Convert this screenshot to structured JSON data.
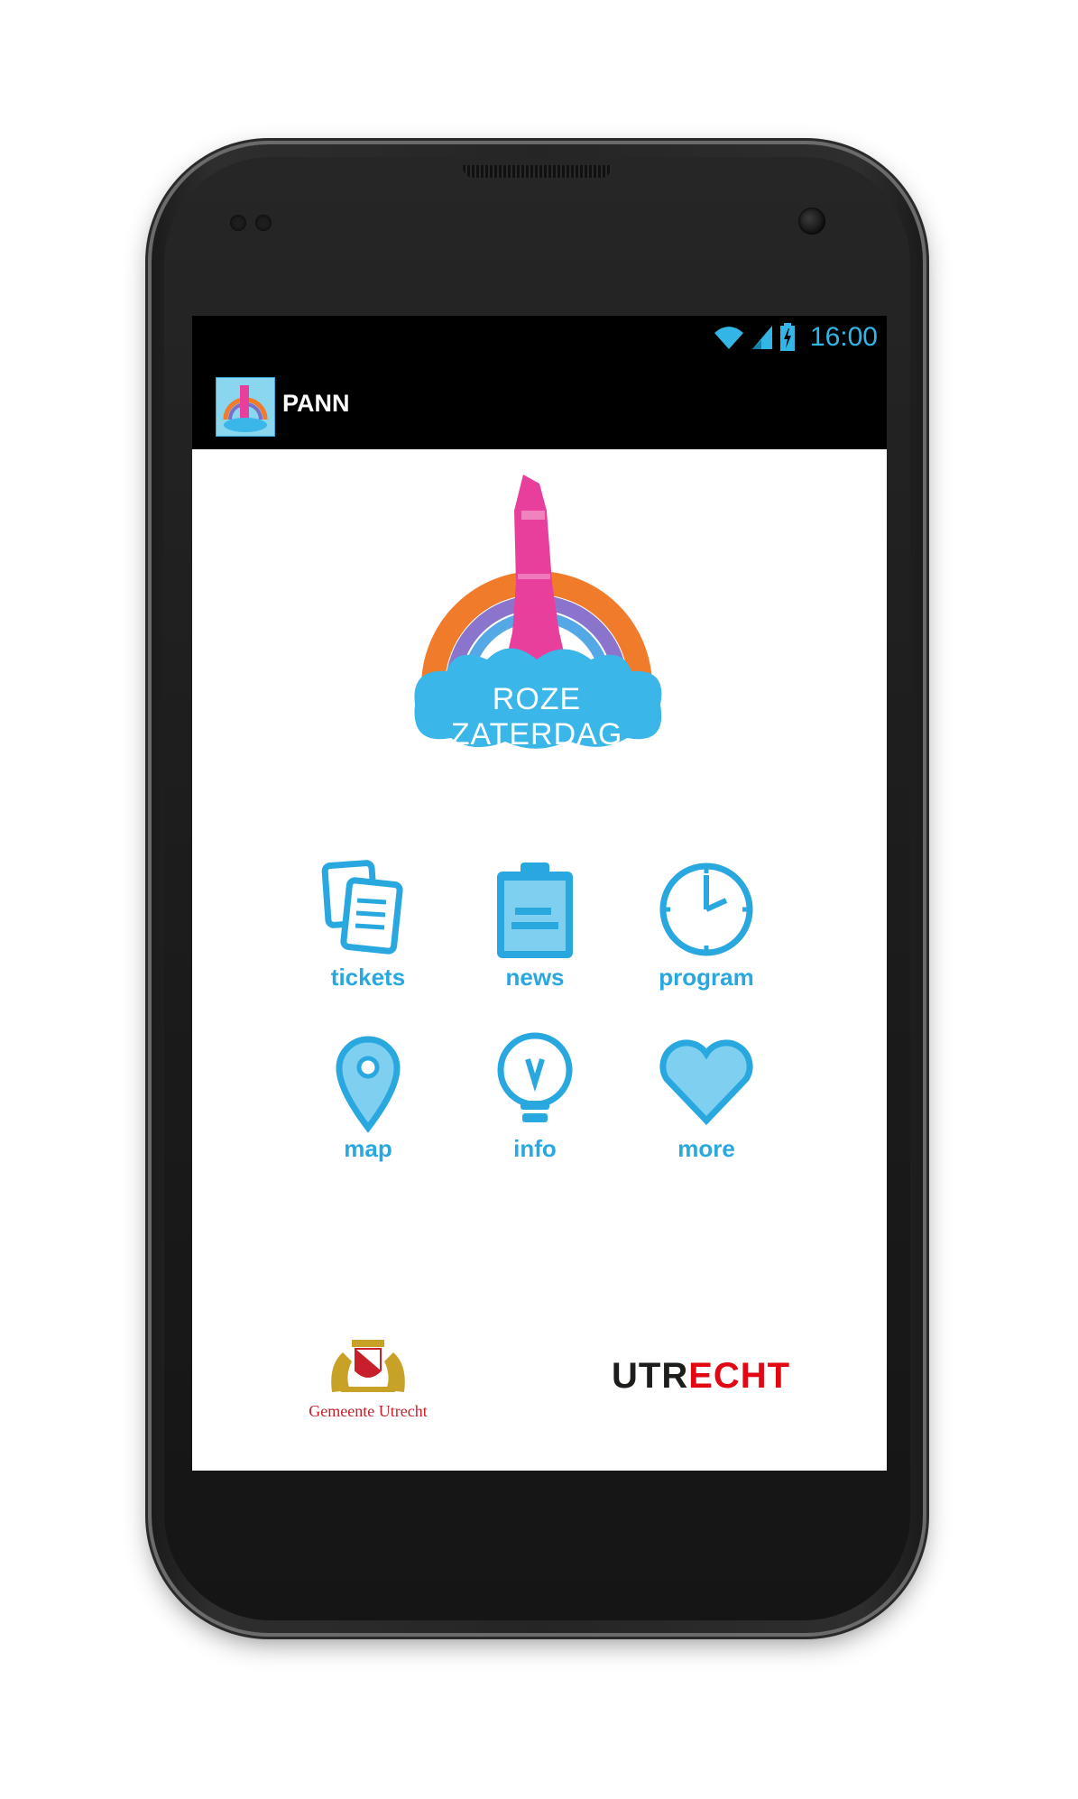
{
  "status_bar": {
    "time": "16:00",
    "icons": [
      "wifi-icon",
      "signal-icon",
      "battery-charging-icon"
    ]
  },
  "action_bar": {
    "title": "PANN",
    "app_icon_text": "ROZE ZATERDAG"
  },
  "logo": {
    "text": "ROZE ZATERDAG"
  },
  "menu": [
    {
      "label": "tickets",
      "icon": "tickets-icon"
    },
    {
      "label": "news",
      "icon": "clipboard-icon"
    },
    {
      "label": "program",
      "icon": "clock-icon"
    },
    {
      "label": "map",
      "icon": "map-pin-icon"
    },
    {
      "label": "info",
      "icon": "lightbulb-icon"
    },
    {
      "label": "more",
      "icon": "heart-icon"
    }
  ],
  "sponsors": {
    "gemeente": "Gemeente Utrecht",
    "utrecht_a": "UTR",
    "utrecht_b": "ECHT"
  },
  "colors": {
    "accent": "#29a8e0",
    "status_accent": "#33b5e5",
    "brand_pink": "#e83f9c",
    "brand_red": "#e30613"
  }
}
